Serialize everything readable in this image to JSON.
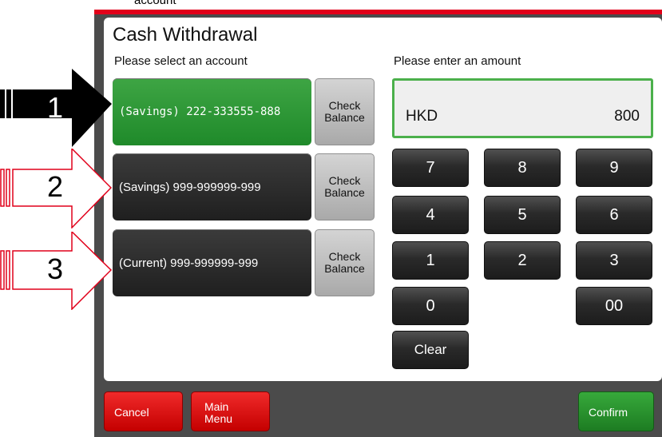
{
  "top_caption": "account",
  "screen": {
    "title": "Cash Withdrawal",
    "account_prompt": "Please select an account",
    "amount_prompt": "Please enter an amount"
  },
  "accounts": [
    {
      "label": "(Savings) 222-333555-888",
      "selected": true,
      "check_label_1": "Check",
      "check_label_2": "Balance"
    },
    {
      "label": "(Savings) 999-999999-999",
      "selected": false,
      "check_label_1": "Check",
      "check_label_2": "Balance"
    },
    {
      "label": "(Current) 999-999999-999",
      "selected": false,
      "check_label_1": "Check",
      "check_label_2": "Balance"
    }
  ],
  "amount": {
    "currency": "HKD",
    "value": "800"
  },
  "keypad": [
    "7",
    "8",
    "9",
    "4",
    "5",
    "6",
    "1",
    "2",
    "3",
    "0",
    "00",
    "Clear"
  ],
  "footer": {
    "cancel": "Cancel",
    "main_menu_1": "Main",
    "main_menu_2": "Menu",
    "confirm": "Confirm"
  },
  "annotations": [
    "1",
    "2",
    "3"
  ],
  "colors": {
    "accent_red": "#e1001a",
    "selected_green": "#2a9a33",
    "confirm_green": "#2a8f2f"
  }
}
